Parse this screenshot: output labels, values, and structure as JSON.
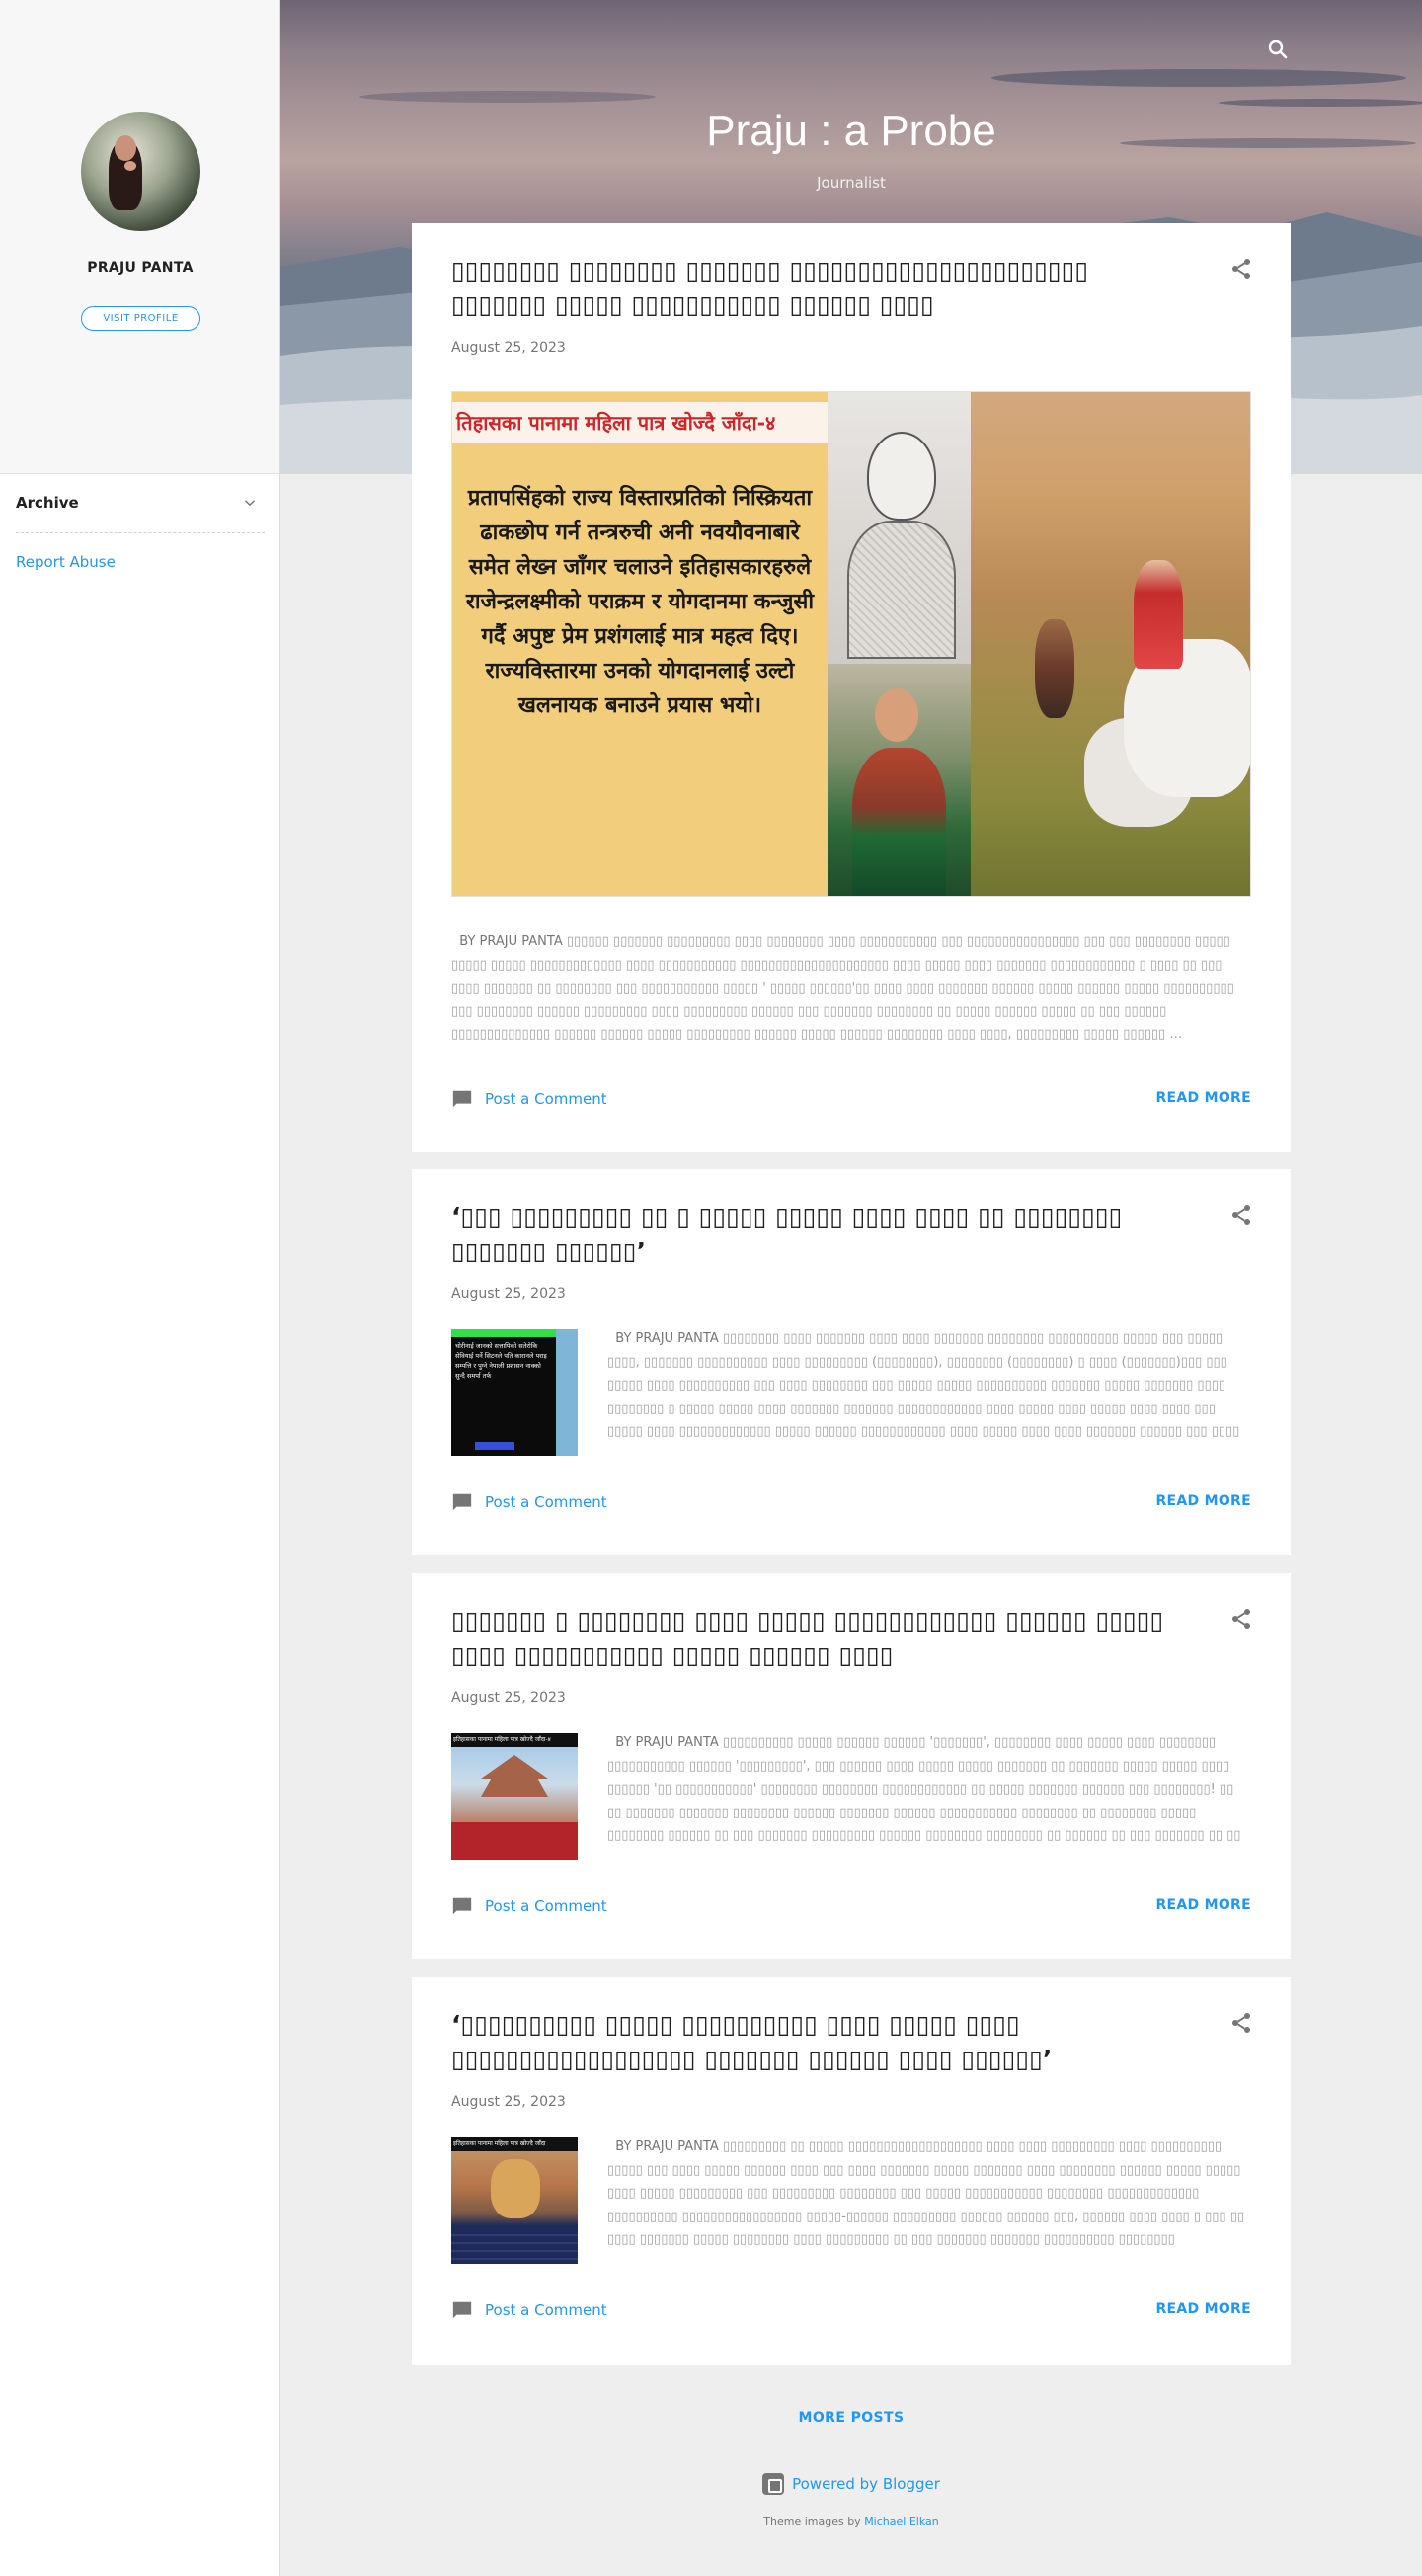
{
  "blog": {
    "title": "Praju : a Probe",
    "description": "Journalist"
  },
  "profile": {
    "name": "PRAJU PANTA",
    "visit_label": "VISIT PROFILE"
  },
  "sidebar": {
    "archive_label": "Archive",
    "report_label": "Report Abuse"
  },
  "posts": [
    {
      "title": "▯▯▯▯▯▯▯▯ ▯▯▯▯▯▯▯▯ ▯▯▯▯▯▯▯ ▯▯▯▯▯▯▯▯▯▯▯▯▯▯▯▯▯▯▯▯▯▯ ▯▯▯▯▯▯▯ ▯▯▯▯▯ ▯▯▯▯▯▯▯▯▯▯▯ ▯▯▯▯▯▯ ▯▯▯▯",
      "date": "August 25, 2023",
      "image_banner": "तिहासका पानामा महिला पात्र खोज्दै जाँदा-४",
      "image_text": "प्रतापसिंहको राज्य विस्तारप्रतिको निस्क्रियता ढाकछोप गर्न तन्त्ररुची अनी नवयौवनाबारे समेत लेख्न जाँगर चलाउने इतिहासकारहरुले राजेन्द्रलक्ष्मीको पराक्रम र योगदानमा कन्जुसी गर्दै अपुष्ट प्रेम प्रशंगलाई मात्र महत्व दिए। राज्यविस्तारमा उनको योगदानलाई उल्टो खलनायक बनाउने प्रयास भयो।",
      "author": "BY PRAJU PANTA",
      "snippet": "▯▯▯▯▯▯ ▯▯▯▯▯▯▯ ▯▯▯▯▯▯▯▯▯ ▯▯▯▯ ▯▯▯▯▯▯▯▯ ▯▯▯▯ ▯▯▯▯▯▯▯▯▯▯▯ ▯▯▯ ▯▯▯▯▯▯▯▯▯▯▯▯▯▯▯▯ ▯▯▯ ▯▯▯ ▯▯▯▯▯▯▯▯ ▯▯▯▯▯ ▯▯▯▯▯ ▯▯▯▯▯ ▯▯▯▯▯▯▯▯▯▯▯▯▯ ▯▯▯▯ ▯▯▯▯▯▯▯▯▯▯▯ ▯▯▯▯▯▯▯▯▯▯▯▯▯▯▯▯▯▯▯▯▯ ▯▯▯▯ ▯▯▯▯▯ ▯▯▯▯ ▯▯▯▯▯▯▯ ▯▯▯▯▯▯▯▯▯▯▯▯ ▯ ▯▯▯▯ ▯▯ ▯▯▯ ▯▯▯▯ ▯▯▯▯▯▯▯ ▯▯ ▯▯▯▯▯▯▯▯ ▯▯▯ ▯▯▯▯▯▯▯▯▯▯▯ ▯▯▯▯▯ ' ▯▯▯▯▯ ▯▯▯▯▯▯'▯▯ ▯▯▯▯ ▯▯▯▯ ▯▯▯▯▯▯▯ ▯▯▯▯▯▯ ▯▯▯▯▯ ▯▯▯▯▯▯ ▯▯▯▯▯ ▯▯▯▯▯▯▯▯▯▯ ▯▯▯ ▯▯▯▯▯▯▯▯ ▯▯▯▯▯▯ ▯▯▯▯▯▯▯▯▯ ▯▯▯▯ ▯▯▯▯▯▯▯▯▯ ▯▯▯▯▯▯ ▯▯▯ ▯▯▯▯▯▯▯ ▯▯▯▯▯▯▯▯ ▯▯ ▯▯▯▯▯ ▯▯▯▯▯▯ ▯▯▯▯▯ ▯▯ ▯▯▯ ▯▯▯▯▯▯ ▯▯▯▯▯▯▯▯▯▯▯▯▯▯ ▯▯▯▯▯▯ ▯▯▯▯▯▯ ▯▯▯▯▯ ▯▯▯▯▯▯▯▯▯ ▯▯▯▯▯▯ ▯▯▯▯▯ ▯▯▯▯▯▯ ▯▯▯▯▯▯▯▯ ▯▯▯▯ ▯▯▯▯, ▯▯▯▯▯▯▯▯▯ ▯▯▯▯▯ ▯▯▯▯▯▯ …",
      "comment_label": "Post a Comment",
      "read_more": "READ MORE"
    },
    {
      "title": "‘▯▯▯ ▯▯▯▯▯▯▯▯▯ ▯▯ ▯ ▯▯▯▯▯ ▯▯▯▯▯ ▯▯▯▯ ▯▯▯▯ ▯▯ ▯▯▯▯▯▯▯▯ ▯▯▯▯▯▯▯ ▯▯▯▯▯▯’",
      "date": "August 25, 2023",
      "thumb_text": "चोरीनाई जानको सत्तापिको सतेरोकि सेवियाई पर्ने सिटनले पति कारानले पराइ सम्पत्ति र पुग्ने नेपाली प्रशासन नाक्को सुन्दै समर्पा तर्फ",
      "author": "BY PRAJU PANTA",
      "snippet": "▯▯▯▯▯▯▯▯ ▯▯▯▯ ▯▯▯▯▯▯▯ ▯▯▯▯ ▯▯▯▯ ▯▯▯▯▯▯▯ ▯▯▯▯▯▯▯▯ ▯▯▯▯▯▯▯▯▯▯ ▯▯▯▯▯ ▯▯▯ ▯▯▯▯▯ ▯▯▯▯, ▯▯▯▯▯▯▯ ▯▯▯▯▯▯▯▯▯▯ ▯▯▯▯ ▯▯▯▯▯▯▯▯▯ (▯▯▯▯▯▯▯▯), ▯▯▯▯▯▯▯▯ (▯▯▯▯▯▯▯▯) ▯ ▯▯▯▯ (▯▯▯▯▯▯▯)▯▯▯ ▯▯▯ ▯▯▯▯▯ ▯▯▯▯ ▯▯▯▯▯▯▯▯▯▯ ▯▯▯ ▯▯▯▯ ▯▯▯▯▯▯▯▯ ▯▯▯ ▯▯▯▯▯ ▯▯▯▯▯ ▯▯▯▯▯▯▯▯▯▯ ▯▯▯▯▯▯▯ ▯▯▯▯▯ ▯▯▯▯▯▯▯ ▯▯▯▯ ▯▯▯▯▯▯▯▯ ▯ ▯▯▯▯▯ ▯▯▯▯▯ ▯▯▯▯ ▯▯▯▯▯▯▯ ▯▯▯▯▯▯▯ ▯▯▯▯▯▯▯▯▯▯▯▯ ▯▯▯▯ ▯▯▯▯▯ ▯▯▯▯ ▯▯▯▯▯ ▯▯▯▯ ▯▯▯▯ ▯▯▯ ▯▯▯▯▯ ▯▯▯▯ ▯▯▯▯▯▯▯▯▯▯▯▯▯ ▯▯▯▯▯ ▯▯▯▯▯▯ ▯▯▯▯▯▯▯▯▯▯▯▯ ▯▯▯▯ ▯▯▯▯▯ ▯▯▯▯ ▯▯▯▯ ▯▯▯▯▯▯▯ ▯▯▯▯▯▯ ▯▯▯ ▯▯▯▯ ▯▯▯▯ …",
      "comment_label": "Post a Comment",
      "read_more": "READ MORE"
    },
    {
      "title": "▯▯▯▯▯▯▯ ▯ ▯▯▯▯▯▯▯▯ ▯▯▯▯ ▯▯▯▯▯ ▯▯▯▯▯▯▯▯▯▯▯▯ ▯▯▯▯▯▯ ▯▯▯▯▯ ▯▯▯▯ ▯▯▯▯▯▯▯▯▯▯▯ ▯▯▯▯▯ ▯▯▯▯▯▯ ▯▯▯▯",
      "date": "August 25, 2023",
      "thumb_text": "इतिहासका पानामा महिला पात्र खोज्दै जाँदा-४",
      "author": "BY PRAJU PANTA",
      "snippet": "▯▯▯▯▯▯▯▯▯▯ ▯▯▯▯▯ ▯▯▯▯▯▯ ▯▯▯▯▯▯ '▯▯▯▯▯▯▯', ▯▯▯▯▯▯▯▯ ▯▯▯▯ ▯▯▯▯▯ ▯▯▯▯ ▯▯▯▯▯▯▯▯ ▯▯▯▯▯▯▯▯▯▯▯ ▯▯▯▯▯▯ '▯▯▯▯▯▯▯▯▯', ▯▯▯ ▯▯▯▯▯▯ ▯▯▯▯ ▯▯▯▯▯ ▯▯▯▯▯ ▯▯▯▯▯▯▯ ▯▯ ▯▯▯▯▯▯▯ ▯▯▯▯▯ ▯▯▯▯▯ ▯▯▯▯ ▯▯▯▯▯▯ '▯▯ ▯▯▯▯▯▯▯▯▯▯▯' ▯▯▯▯▯▯▯▯ ▯▯▯▯▯▯▯▯ ▯▯▯▯▯▯▯▯▯▯▯▯ ▯▯ ▯▯▯▯▯ ▯▯▯▯▯▯▯ ▯▯▯▯▯▯ ▯▯▯ ▯▯▯▯▯▯▯▯! ▯▯ ▯▯ ▯▯▯▯▯▯▯ ▯▯▯▯▯▯▯ ▯▯▯▯▯▯▯▯ ▯▯▯▯▯▯ ▯▯▯▯▯▯▯ ▯▯▯▯▯▯ ▯▯▯▯▯▯▯▯▯▯▯ ▯▯▯▯▯▯▯▯ ▯▯ ▯▯▯▯▯▯▯▯ ▯▯▯▯▯ ▯▯▯▯▯▯▯▯ ▯▯▯▯▯▯ ▯▯ ▯▯▯ ▯▯▯▯▯▯▯ ▯▯▯▯▯▯▯▯▯ ▯▯▯▯▯▯ ▯▯▯▯▯▯▯▯ ▯▯▯▯▯▯▯▯ ▯▯ ▯▯▯▯▯▯ ▯▯ ▯▯▯ ▯▯▯▯▯▯▯ ▯▯ ▯▯ …",
      "comment_label": "Post a Comment",
      "read_more": "READ MORE"
    },
    {
      "title": "‘▯▯▯▯▯▯▯▯▯▯ ▯▯▯▯▯ ▯▯▯▯▯▯▯▯▯▯ ▯▯▯▯ ▯▯▯▯▯ ▯▯▯▯ ▯▯▯▯▯▯▯▯▯▯▯▯▯▯▯▯▯▯ ▯▯▯▯▯▯▯ ▯▯▯▯▯▯ ▯▯▯▯ ▯▯▯▯▯▯’",
      "date": "August 25, 2023",
      "thumb_text": "इतिहासका पानामा महिला पात्र खोज्दै जाँदा",
      "author": "BY PRAJU PANTA",
      "snippet": "▯▯▯▯▯▯▯▯▯ ▯▯ ▯▯▯▯▯ ▯▯▯▯▯▯▯▯▯▯▯▯▯▯▯▯▯▯▯ ▯▯▯▯ ▯▯▯▯ ▯▯▯▯▯▯▯▯▯ ▯▯▯▯ ▯▯▯▯▯▯▯▯▯▯ ▯▯▯▯▯ ▯▯▯ ▯▯▯▯ ▯▯▯▯▯ ▯▯▯▯▯▯ ▯▯▯▯ ▯▯▯ ▯▯▯▯ ▯▯▯▯▯▯▯ ▯▯▯▯▯ ▯▯▯▯▯▯▯ ▯▯▯▯ ▯▯▯▯▯▯▯▯ ▯▯▯▯▯▯ ▯▯▯▯▯ ▯▯▯▯▯ ▯▯▯▯ ▯▯▯▯▯ ▯▯▯▯▯▯▯▯▯ ▯▯▯ ▯▯▯▯▯▯▯▯▯ ▯▯▯▯▯▯▯▯ ▯▯▯ ▯▯▯▯▯ ▯▯▯▯▯▯▯▯▯▯▯ ▯▯▯▯▯▯▯▯ ▯▯▯▯▯▯▯▯▯▯▯▯▯ ▯▯▯▯▯▯▯▯▯▯ ▯▯▯▯▯▯▯▯▯▯▯▯▯▯▯▯▯ ▯▯▯▯▯-▯▯▯▯▯▯ ▯▯▯▯▯▯▯▯▯ ▯▯▯▯▯▯ ▯▯▯▯▯▯ ▯▯▯, ▯▯▯▯▯▯ ▯▯▯▯ ▯▯▯▯ ▯ ▯▯▯ ▯▯ ▯▯▯▯ ▯▯▯▯▯▯▯ ▯▯▯▯▯ ▯▯▯▯▯▯▯▯ ▯▯▯▯ ▯▯▯▯▯▯▯▯▯ ▯▯ ▯▯▯ ▯▯▯▯▯▯▯ ▯▯▯▯▯▯▯ ▯▯▯▯▯▯▯▯▯▯ ▯▯▯▯▯▯▯▯ ▯▯▯▯▯▯▯▯▯▯▯▯▯▯▯▯▯▯▯▯ ▯▯ …",
      "comment_label": "Post a Comment",
      "read_more": "READ MORE"
    }
  ],
  "footer": {
    "more_posts": "MORE POSTS",
    "powered_by": "Powered by Blogger",
    "theme_images_prefix": "Theme images by",
    "theme_images_author": "Michael Elkan"
  },
  "colors": {
    "accent": "#2196f3",
    "background": "#eeeeee",
    "card": "#ffffff"
  },
  "icons": [
    "search-icon",
    "share-icon",
    "comment-icon",
    "chevron-down-icon",
    "blogger-icon"
  ]
}
